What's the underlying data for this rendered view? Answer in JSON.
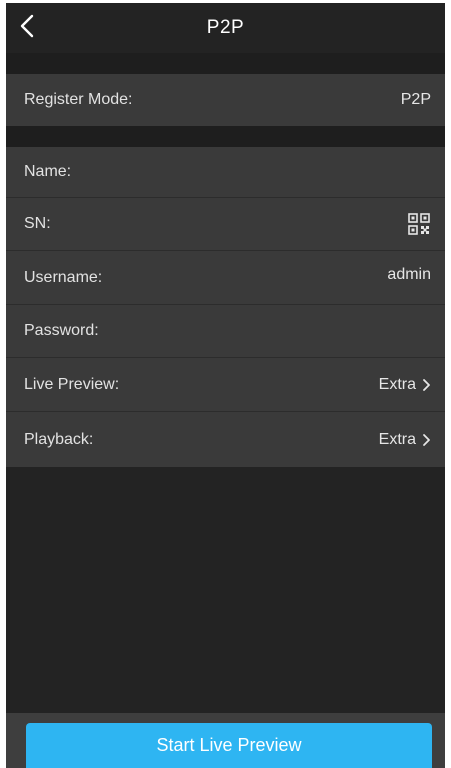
{
  "header": {
    "title": "P2P",
    "back_icon": "chevron-left-icon"
  },
  "register": {
    "label": "Register Mode:",
    "value": "P2P"
  },
  "fields": {
    "name_label": "Name:",
    "name_value": "",
    "sn_label": "SN:",
    "sn_icon": "qr-code-icon",
    "username_label": "Username:",
    "username_value": "admin",
    "password_label": "Password:",
    "password_value": "",
    "live_preview_label": "Live Preview:",
    "live_preview_value": "Extra",
    "playback_label": "Playback:",
    "playback_value": "Extra"
  },
  "footer": {
    "start_label": "Start Live Preview"
  },
  "colors": {
    "background": "#232323",
    "row": "#3a3a3a",
    "accent": "#2eb5f2",
    "text": "#e6e6e6"
  }
}
